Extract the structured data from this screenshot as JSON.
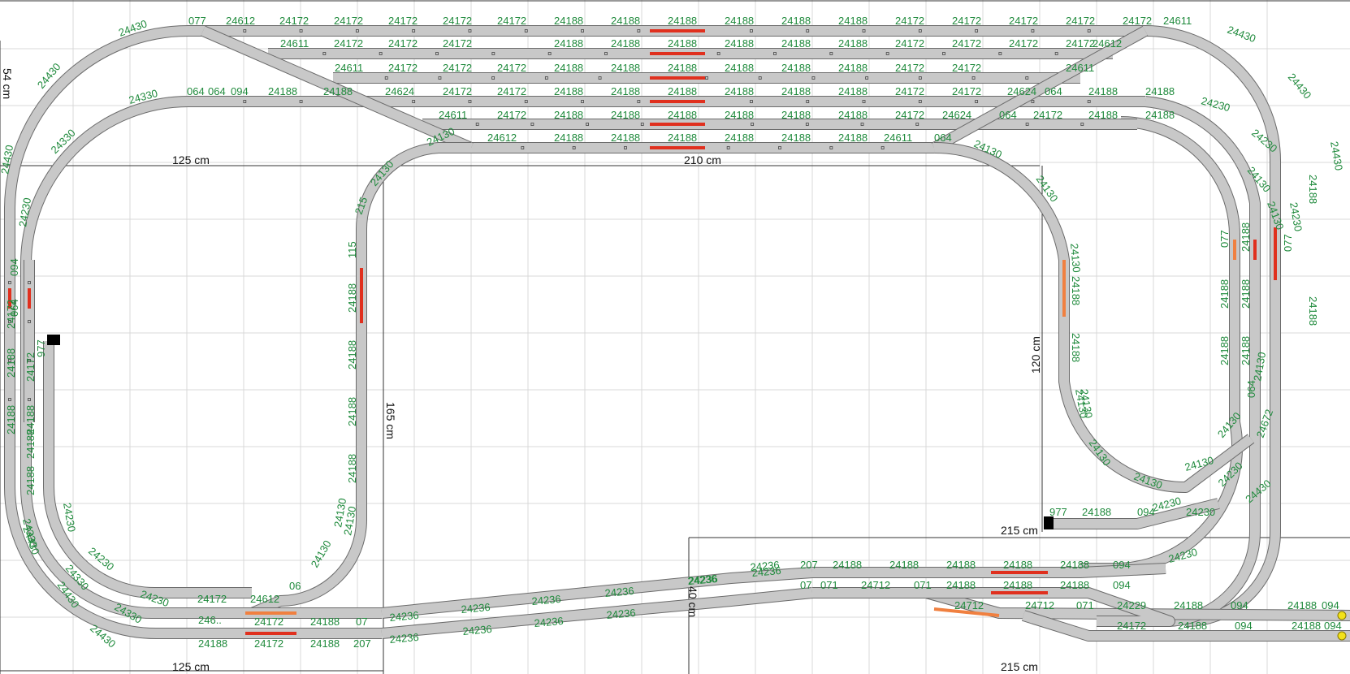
{
  "colors": {
    "background": "#ffffff",
    "grid": "#d9d9d9",
    "rail_fill": "#c8c8c8",
    "rail_edge": "#6b6b6b",
    "label": "#1f8a3c",
    "dimension_text": "#111111",
    "signal_red": "#e0301e",
    "signal_orange": "#f08040",
    "buffer_stop": "#000000",
    "end_marker": "#f2e21a"
  },
  "dimensions": {
    "left_width": "125 cm",
    "left_width_bottom": "125 cm",
    "top_width": "210 cm",
    "inner_height": "165 cm",
    "right_inner_height": "120 cm",
    "right_width": "215 cm",
    "right_width_bottom": "215 cm",
    "left_edge_height": "54 cm",
    "middle_small": "40 cm"
  },
  "labels": {
    "top_row": [
      "077",
      "24612",
      "24172",
      "24172",
      "24172",
      "24172",
      "24172",
      "24188",
      "24188",
      "24188",
      "24188",
      "24188",
      "24188",
      "24172",
      "24172",
      "24172",
      "24172",
      "24172",
      "24611"
    ],
    "row2": [
      "24611",
      "24172",
      "24172",
      "24172",
      "24188",
      "24188",
      "24188",
      "24188",
      "24188",
      "24188",
      "24172",
      "24172",
      "24172",
      "24172",
      "24612"
    ],
    "row3": [
      "24611",
      "24172",
      "24172",
      "24172",
      "24188",
      "24188",
      "24188",
      "24188",
      "24188",
      "24188",
      "24172",
      "24172",
      "24611"
    ],
    "row4": [
      "064",
      "064",
      "094",
      "24188",
      "24188",
      "24624",
      "24172",
      "24172",
      "24188",
      "24188",
      "24188",
      "24188",
      "24188",
      "24188",
      "24172",
      "24172",
      "24624",
      "064",
      "24188",
      "24188"
    ],
    "row5": [
      "24611",
      "24172",
      "24188",
      "24188",
      "24188",
      "24188",
      "24188",
      "24188",
      "24172",
      "24624",
      "064",
      "24172",
      "24188",
      "24188"
    ],
    "row6": [
      "24612",
      "24188",
      "24188",
      "24188",
      "24188",
      "24188",
      "24188",
      "24611",
      "064"
    ],
    "outer_curves": [
      "24430",
      "24430",
      "24430",
      "24430",
      "24430",
      "24430",
      "24430",
      "24430",
      "24430",
      "24430"
    ],
    "curves_330": [
      "24330",
      "24330",
      "24330",
      "24330",
      "24330"
    ],
    "curves_230": [
      "24230",
      "24230",
      "24230",
      "24230",
      "24230",
      "24230",
      "24230",
      "24230",
      "24230"
    ],
    "curves_130": [
      "24130",
      "24130",
      "24130",
      "24130",
      "24130",
      "24130",
      "24130",
      "24130",
      "24130",
      "24130",
      "24130",
      "24130",
      "24130",
      "24130",
      "24130"
    ],
    "left_straights": [
      "24172",
      "24188",
      "24188",
      "24188",
      "24172",
      "24188",
      "24188",
      "977",
      "064",
      "094"
    ],
    "inner_loop_left": [
      "215",
      "115",
      "24188",
      "24188",
      "24188",
      "24188",
      "24130"
    ],
    "inner_loop_right": [
      "24188",
      "24188",
      "24130"
    ],
    "right_straights": [
      "077",
      "24188",
      "24188",
      "077",
      "24188",
      "24188",
      "24188",
      "24188",
      "24188",
      "064",
      "24672"
    ],
    "bottom_left": [
      "24172",
      "24612",
      "06",
      "246..",
      "24172",
      "24188",
      "07",
      "24188",
      "24172",
      "24188",
      "207"
    ],
    "bottom_diag": [
      "24236",
      "24236",
      "24236",
      "24236",
      "24236",
      "24236",
      "24236",
      "24236",
      "24236",
      "24236"
    ],
    "bottom_right_row1": [
      "207",
      "24188",
      "24188",
      "24188",
      "24188",
      "24188",
      "094"
    ],
    "bottom_right_row2": [
      "07",
      "071",
      "24712",
      "071",
      "24188",
      "24188",
      "24188",
      "094"
    ],
    "bottom_right_row3": [
      "24712",
      "24712",
      "071",
      "24229",
      "24188",
      "094",
      "24188",
      "094"
    ],
    "bottom_right_row4": [
      "24172",
      "24188",
      "094",
      "24188",
      "094"
    ],
    "siding": [
      "977",
      "24188",
      "094",
      "24230"
    ],
    "misc": [
      "24236",
      "24236",
      "24230"
    ]
  }
}
